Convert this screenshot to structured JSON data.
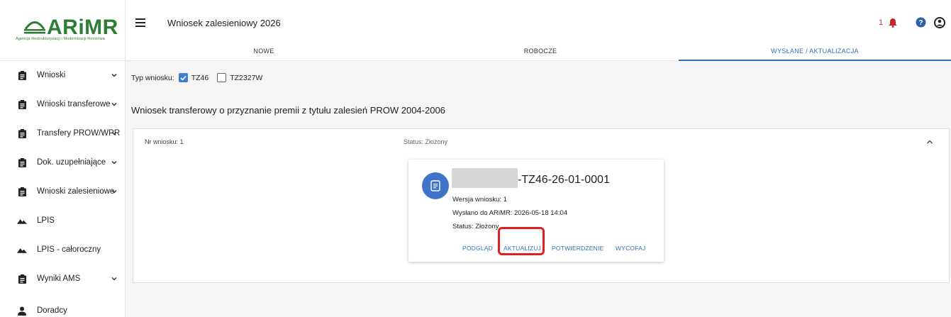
{
  "logo": {
    "name": "ARiMR",
    "subtitle": "Agencja Restrukturyzacji i Modernizacji Rolnictwa"
  },
  "sidebar": {
    "items": [
      {
        "label": "Wnioski",
        "icon": "clipboard-icon",
        "expandable": true
      },
      {
        "label": "Wnioski transferowe",
        "icon": "clipboard-icon",
        "expandable": true
      },
      {
        "label": "Transfery PROW/WPR",
        "icon": "clipboard-icon",
        "expandable": true
      },
      {
        "label": "Dok. uzupełniające",
        "icon": "clipboard-icon",
        "expandable": true
      },
      {
        "label": "Wnioski zalesieniowe",
        "icon": "clipboard-icon",
        "expandable": true
      },
      {
        "label": "LPIS",
        "icon": "terrain-icon",
        "expandable": false
      },
      {
        "label": "LPIS - całoroczny",
        "icon": "terrain-icon",
        "expandable": false
      },
      {
        "label": "Wyniki AMS",
        "icon": "clipboard-icon",
        "expandable": true
      },
      {
        "label": "Doradcy",
        "icon": "person-icon",
        "expandable": false
      }
    ]
  },
  "header": {
    "title": "Wniosek zalesieniowy 2026",
    "notification_count": "1",
    "tabs": [
      {
        "label": "NOWE",
        "active": false
      },
      {
        "label": "ROBOCZE",
        "active": false
      },
      {
        "label": "WYSŁANE / AKTUALIZACJA",
        "active": true
      }
    ]
  },
  "filter": {
    "label": "Typ wniosku:",
    "options": [
      {
        "label": "TZ46",
        "checked": true
      },
      {
        "label": "TZ2327W",
        "checked": false
      }
    ]
  },
  "section_title": "Wniosek transferowy o przyznanie premii z tytułu zalesień PROW 2004-2006",
  "panel": {
    "number_label": "Nr wniosku: 1",
    "status_label": "Status: Złożony"
  },
  "card": {
    "application_number": "-TZ46-26-01-0001",
    "version": "Wersja wniosku: 1",
    "sent": "Wysłano do ARiMR: 2026-05-18 14:04",
    "status": "Status: Złożony",
    "actions": [
      "PODGLĄD",
      "AKTUALIZUJ",
      "POTWIERDZENIE",
      "WYCOFAJ"
    ]
  },
  "colors": {
    "accent": "#2f6fb5",
    "brand": "#2e7d32",
    "highlight": "#e02020",
    "notification": "#c62828"
  }
}
